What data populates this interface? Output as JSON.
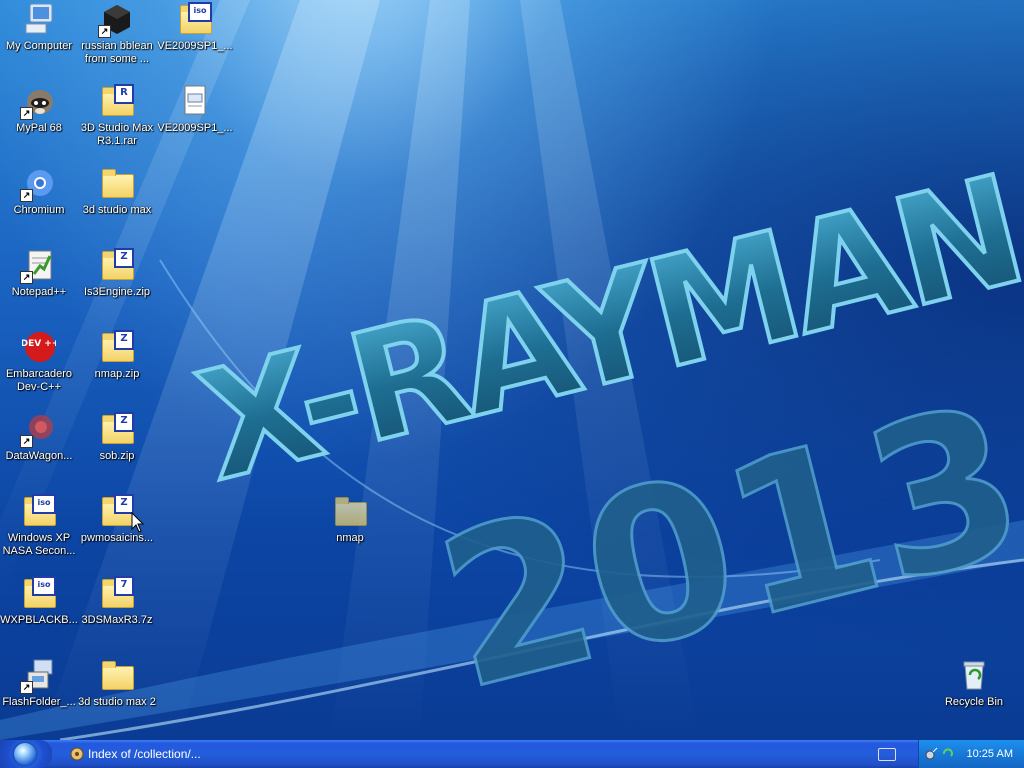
{
  "desktop": {
    "wallpaper_title": "X-RAYMAN",
    "wallpaper_year": "2013",
    "icons": [
      {
        "label": "My Computer"
      },
      {
        "label": "russian bblean from some ..."
      },
      {
        "label": "VE2009SP1_..."
      },
      {
        "label": "MyPal 68"
      },
      {
        "label": "3D Studio Max R3.1.rar"
      },
      {
        "label": "VE2009SP1_..."
      },
      {
        "label": "Chromium"
      },
      {
        "label": "3d studio max"
      },
      {
        "label": "Notepad++"
      },
      {
        "label": "Is3Engine.zip"
      },
      {
        "label": "Embarcadero Dev-C++"
      },
      {
        "label": "nmap.zip"
      },
      {
        "label": "DataWagon..."
      },
      {
        "label": "sob.zip"
      },
      {
        "label": "Windows XP NASA Secon..."
      },
      {
        "label": "pwmosaicins..."
      },
      {
        "label": "WXPBLACKB..."
      },
      {
        "label": "3DSMaxR3.7z"
      },
      {
        "label": "FlashFolder_..."
      },
      {
        "label": "3d studio max 2"
      },
      {
        "label": "nmap"
      },
      {
        "label": "Recycle Bin"
      }
    ],
    "badges": {
      "iso": "iso",
      "rar": "R",
      "zip": "Z",
      "seven": "7",
      "dev": "DEV ++"
    }
  },
  "taskbar": {
    "window_title": "Index of /collection/...",
    "clock": "10:25 AM"
  },
  "colors": {
    "taskbar_blue": "#245ddb",
    "tray_blue": "#1779d8",
    "wallpaper_text": "#1d6e93"
  }
}
